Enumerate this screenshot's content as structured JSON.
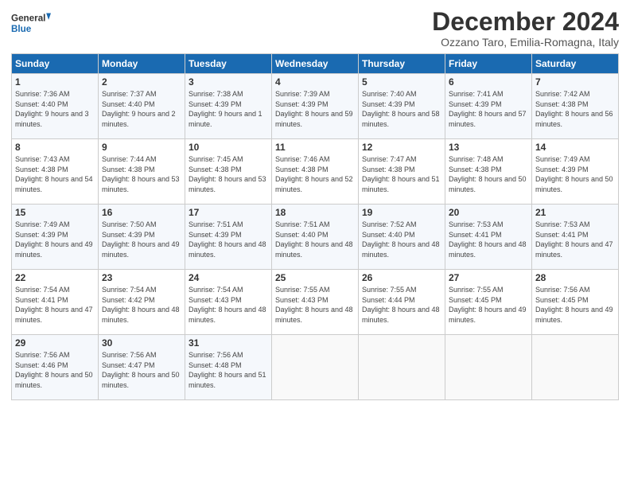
{
  "header": {
    "logo_line1": "General",
    "logo_line2": "Blue",
    "title": "December 2024",
    "subtitle": "Ozzano Taro, Emilia-Romagna, Italy"
  },
  "columns": [
    "Sunday",
    "Monday",
    "Tuesday",
    "Wednesday",
    "Thursday",
    "Friday",
    "Saturday"
  ],
  "weeks": [
    [
      {
        "day": "1",
        "sunrise": "7:36 AM",
        "sunset": "4:40 PM",
        "daylight": "9 hours and 3 minutes."
      },
      {
        "day": "2",
        "sunrise": "7:37 AM",
        "sunset": "4:40 PM",
        "daylight": "9 hours and 2 minutes."
      },
      {
        "day": "3",
        "sunrise": "7:38 AM",
        "sunset": "4:39 PM",
        "daylight": "9 hours and 1 minute."
      },
      {
        "day": "4",
        "sunrise": "7:39 AM",
        "sunset": "4:39 PM",
        "daylight": "8 hours and 59 minutes."
      },
      {
        "day": "5",
        "sunrise": "7:40 AM",
        "sunset": "4:39 PM",
        "daylight": "8 hours and 58 minutes."
      },
      {
        "day": "6",
        "sunrise": "7:41 AM",
        "sunset": "4:39 PM",
        "daylight": "8 hours and 57 minutes."
      },
      {
        "day": "7",
        "sunrise": "7:42 AM",
        "sunset": "4:38 PM",
        "daylight": "8 hours and 56 minutes."
      }
    ],
    [
      {
        "day": "8",
        "sunrise": "7:43 AM",
        "sunset": "4:38 PM",
        "daylight": "8 hours and 54 minutes."
      },
      {
        "day": "9",
        "sunrise": "7:44 AM",
        "sunset": "4:38 PM",
        "daylight": "8 hours and 53 minutes."
      },
      {
        "day": "10",
        "sunrise": "7:45 AM",
        "sunset": "4:38 PM",
        "daylight": "8 hours and 53 minutes."
      },
      {
        "day": "11",
        "sunrise": "7:46 AM",
        "sunset": "4:38 PM",
        "daylight": "8 hours and 52 minutes."
      },
      {
        "day": "12",
        "sunrise": "7:47 AM",
        "sunset": "4:38 PM",
        "daylight": "8 hours and 51 minutes."
      },
      {
        "day": "13",
        "sunrise": "7:48 AM",
        "sunset": "4:38 PM",
        "daylight": "8 hours and 50 minutes."
      },
      {
        "day": "14",
        "sunrise": "7:49 AM",
        "sunset": "4:39 PM",
        "daylight": "8 hours and 50 minutes."
      }
    ],
    [
      {
        "day": "15",
        "sunrise": "7:49 AM",
        "sunset": "4:39 PM",
        "daylight": "8 hours and 49 minutes."
      },
      {
        "day": "16",
        "sunrise": "7:50 AM",
        "sunset": "4:39 PM",
        "daylight": "8 hours and 49 minutes."
      },
      {
        "day": "17",
        "sunrise": "7:51 AM",
        "sunset": "4:39 PM",
        "daylight": "8 hours and 48 minutes."
      },
      {
        "day": "18",
        "sunrise": "7:51 AM",
        "sunset": "4:40 PM",
        "daylight": "8 hours and 48 minutes."
      },
      {
        "day": "19",
        "sunrise": "7:52 AM",
        "sunset": "4:40 PM",
        "daylight": "8 hours and 48 minutes."
      },
      {
        "day": "20",
        "sunrise": "7:53 AM",
        "sunset": "4:41 PM",
        "daylight": "8 hours and 48 minutes."
      },
      {
        "day": "21",
        "sunrise": "7:53 AM",
        "sunset": "4:41 PM",
        "daylight": "8 hours and 47 minutes."
      }
    ],
    [
      {
        "day": "22",
        "sunrise": "7:54 AM",
        "sunset": "4:41 PM",
        "daylight": "8 hours and 47 minutes."
      },
      {
        "day": "23",
        "sunrise": "7:54 AM",
        "sunset": "4:42 PM",
        "daylight": "8 hours and 48 minutes."
      },
      {
        "day": "24",
        "sunrise": "7:54 AM",
        "sunset": "4:43 PM",
        "daylight": "8 hours and 48 minutes."
      },
      {
        "day": "25",
        "sunrise": "7:55 AM",
        "sunset": "4:43 PM",
        "daylight": "8 hours and 48 minutes."
      },
      {
        "day": "26",
        "sunrise": "7:55 AM",
        "sunset": "4:44 PM",
        "daylight": "8 hours and 48 minutes."
      },
      {
        "day": "27",
        "sunrise": "7:55 AM",
        "sunset": "4:45 PM",
        "daylight": "8 hours and 49 minutes."
      },
      {
        "day": "28",
        "sunrise": "7:56 AM",
        "sunset": "4:45 PM",
        "daylight": "8 hours and 49 minutes."
      }
    ],
    [
      {
        "day": "29",
        "sunrise": "7:56 AM",
        "sunset": "4:46 PM",
        "daylight": "8 hours and 50 minutes."
      },
      {
        "day": "30",
        "sunrise": "7:56 AM",
        "sunset": "4:47 PM",
        "daylight": "8 hours and 50 minutes."
      },
      {
        "day": "31",
        "sunrise": "7:56 AM",
        "sunset": "4:48 PM",
        "daylight": "8 hours and 51 minutes."
      },
      null,
      null,
      null,
      null
    ]
  ]
}
